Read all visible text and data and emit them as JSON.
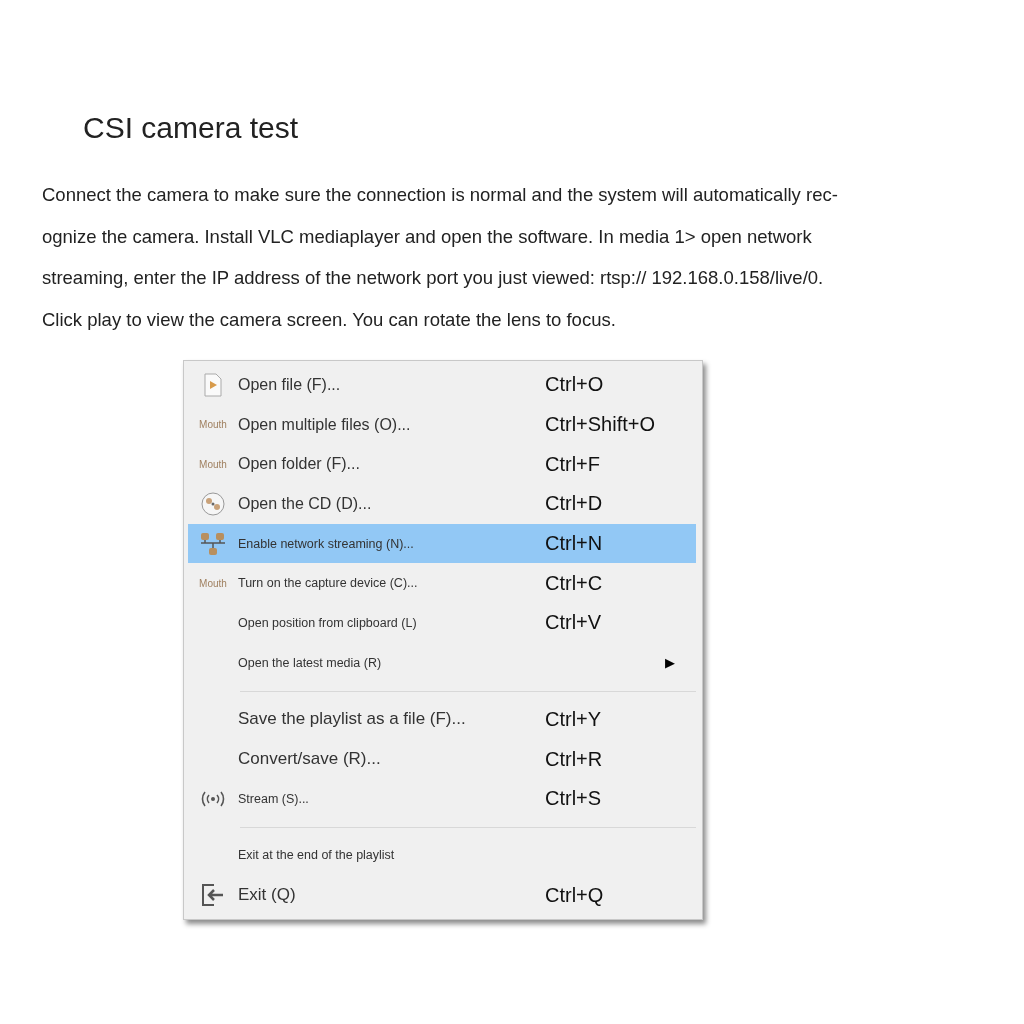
{
  "title": "CSI camera test",
  "description": [
    "Connect the camera to make sure the connection is normal and the system will automatically rec-",
    "ognize the camera. Install VLC mediaplayer and open the software. In media 1> open network",
    "streaming, enter the IP address of the network port you just viewed: rtsp:// 192.168.0.158/live/0.",
    "Click play to view the camera screen. You can rotate the lens to focus."
  ],
  "menu": {
    "items": [
      {
        "kind": "item",
        "label": "Open file (F)...",
        "shortcut": "Ctrl+O",
        "selected": false
      },
      {
        "kind": "item",
        "icon_text": "Mouth",
        "label": "Open multiple files (O)...",
        "shortcut": "Ctrl+Shift+O",
        "selected": false
      },
      {
        "kind": "item",
        "icon_text": "Mouth",
        "label": "Open folder (F)...",
        "shortcut": "Ctrl+F",
        "selected": false
      },
      {
        "kind": "item",
        "label": "Open the CD (D)...",
        "shortcut": "Ctrl+D",
        "selected": false
      },
      {
        "kind": "item",
        "label": "Enable network streaming (N)...",
        "shortcut": "Ctrl+N",
        "selected": true
      },
      {
        "kind": "item",
        "icon_text": "Mouth",
        "label": "Turn on the capture device (C)...",
        "shortcut": "Ctrl+C",
        "selected": false
      },
      {
        "kind": "item",
        "label": "Open position from clipboard (L)",
        "shortcut": "Ctrl+V",
        "selected": false
      },
      {
        "kind": "submenu",
        "label": "Open the latest media (R)",
        "arrow": "▶",
        "selected": false
      },
      {
        "kind": "separator"
      },
      {
        "kind": "item",
        "label": "Save the playlist as a file (F)...",
        "shortcut": "Ctrl+Y",
        "selected": false
      },
      {
        "kind": "item",
        "label": "Convert/save (R)...",
        "shortcut": "Ctrl+R",
        "selected": false
      },
      {
        "kind": "item",
        "label": "Stream (S)...",
        "shortcut": "Ctrl+S",
        "selected": false
      },
      {
        "kind": "separator"
      },
      {
        "kind": "item",
        "label": "Exit at the end of the playlist",
        "selected": false
      },
      {
        "kind": "item",
        "label": "Exit (Q)",
        "shortcut": "Ctrl+Q",
        "selected": false
      }
    ]
  }
}
